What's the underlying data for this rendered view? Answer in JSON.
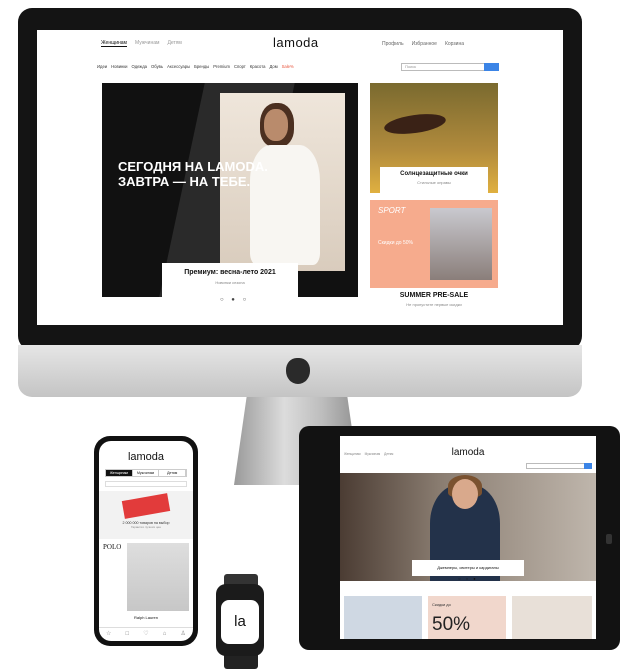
{
  "desktop": {
    "tabs": [
      "Женщинам",
      "Мужчинам",
      "Детям"
    ],
    "logo": "lamoda",
    "account": [
      "Профиль",
      "Избранное",
      "Корзина"
    ],
    "badge": "",
    "nav": [
      "Идеи",
      "Новинки",
      "Одежда",
      "Обувь",
      "Аксессуары",
      "Бренды",
      "Premium",
      "Спорт",
      "Красота",
      "Дом",
      "Sale%"
    ],
    "search_placeholder": "Поиск",
    "hero": {
      "headline": "СЕГОДНЯ НА LAMODA. ЗАВТРА — НА ТЕБЕ.",
      "card_title": "Премиум: весна-лето 2021",
      "card_sub": "Новинки сезона",
      "dots": "○ ● ○"
    },
    "promo_sunglasses": {
      "title": "Солнцезащитные очки",
      "sub": "Стильные оправы"
    },
    "promo_sport": {
      "label": "SPORT",
      "discount": "Скидки до 50%",
      "title": "SUMMER PRE-SALE",
      "sub": "Не пропустите первые скидки"
    }
  },
  "phone": {
    "logo": "lamoda",
    "tabs": [
      "Женщинам",
      "Мужчинам",
      "Детям"
    ],
    "banner_text": "2 000 000 товаров на выбор",
    "banner_sub": "Гарантия лучших цен",
    "polo": "POLO",
    "brand": "Ralph Lauren",
    "bar_icons": [
      "☆",
      "□",
      "♡",
      "⌂",
      "♙"
    ]
  },
  "watch": {
    "logo": "la"
  },
  "tablet": {
    "logo": "lamoda",
    "tabs": [
      "Женщинам",
      "Мужчинам",
      "Детям"
    ],
    "hero_card": "Джемперы, свитеры и кардиганы",
    "dots": "○ ○ ●",
    "tile2_small": "Скидки до",
    "tile2_big": "50%"
  },
  "colors": {
    "accent": "#3b84e6",
    "sale": "#e8543c",
    "promo_peach": "#f6ab8d"
  }
}
